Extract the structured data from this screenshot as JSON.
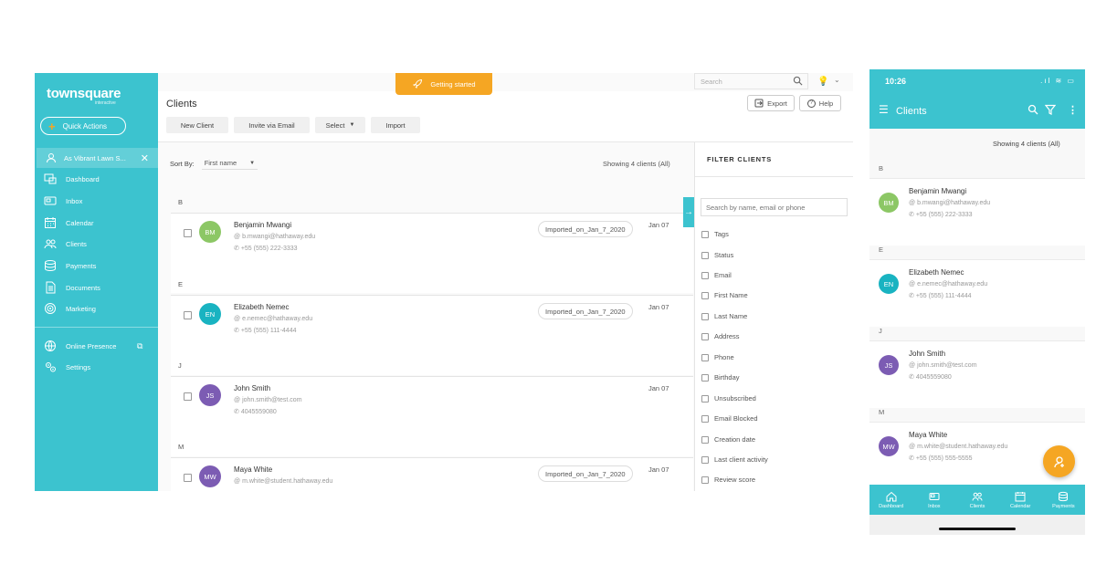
{
  "colors": {
    "accent": "#3cc3cf",
    "orange": "#f5a623",
    "avatar_green": "#8cc765",
    "avatar_teal": "#19b3c1",
    "avatar_purple": "#7c5cb3"
  },
  "desktop": {
    "brand": {
      "logo": "townsquare",
      "sub": "interactive"
    },
    "sidebar": {
      "quick_actions": "Quick Actions",
      "business": "As Vibrant Lawn S...",
      "items": [
        {
          "label": "Dashboard",
          "icon": "dashboard-icon"
        },
        {
          "label": "Inbox",
          "icon": "inbox-icon"
        },
        {
          "label": "Calendar",
          "icon": "calendar-icon"
        },
        {
          "label": "Clients",
          "icon": "clients-icon"
        },
        {
          "label": "Payments",
          "icon": "payments-icon"
        },
        {
          "label": "Documents",
          "icon": "documents-icon"
        },
        {
          "label": "Marketing",
          "icon": "marketing-icon"
        },
        {
          "label": "Online Presence",
          "icon": "globe-icon"
        },
        {
          "label": "Settings",
          "icon": "settings-icon"
        }
      ]
    },
    "topbar": {
      "getting_started": "Getting started",
      "search_placeholder": "Search"
    },
    "header": {
      "title": "Clients",
      "export": "Export",
      "help": "Help",
      "buttons": {
        "new_client": "New Client",
        "invite": "Invite via Email",
        "select": "Select",
        "import": "Import"
      }
    },
    "list": {
      "sort_label": "Sort By:",
      "sort_value": "First name",
      "showing": "Showing 4 clients (All)",
      "groups": [
        {
          "letter": "B",
          "client": {
            "initials": "BM",
            "name": "Benjamin Mwangi",
            "email": "b.mwangi@hathaway.edu",
            "phone": "+55 (555) 222-3333",
            "tag": "Imported_on_Jan_7_2020",
            "date": "Jan 07"
          }
        },
        {
          "letter": "E",
          "client": {
            "initials": "EN",
            "name": "Elizabeth Nemec",
            "email": "e.nemec@hathaway.edu",
            "phone": "+55 (555) 111-4444",
            "tag": "Imported_on_Jan_7_2020",
            "date": "Jan 07"
          }
        },
        {
          "letter": "J",
          "client": {
            "initials": "JS",
            "name": "John Smith",
            "email": "john.smith@test.com",
            "phone": "4045559080",
            "tag": "",
            "date": "Jan 07"
          }
        },
        {
          "letter": "M",
          "client": {
            "initials": "MW",
            "name": "Maya White",
            "email": "m.white@student.hathaway.edu",
            "phone": "",
            "tag": "Imported_on_Jan_7_2020",
            "date": "Jan 07"
          }
        }
      ]
    },
    "filter": {
      "title": "FILTER CLIENTS",
      "search_placeholder": "Search by name, email or phone",
      "options": [
        "Tags",
        "Status",
        "Email",
        "First Name",
        "Last Name",
        "Address",
        "Phone",
        "Birthday",
        "Unsubscribed",
        "Email Blocked",
        "Creation date",
        "Last client activity",
        "Review score"
      ]
    }
  },
  "mobile": {
    "time": "10:26",
    "title": "Clients",
    "showing": "Showing 4 clients (All)",
    "groups": [
      {
        "letter": "B",
        "client": {
          "initials": "BM",
          "name": "Benjamin Mwangi",
          "email": "b.mwangi@hathaway.edu",
          "phone": "+55 (555) 222-3333"
        }
      },
      {
        "letter": "E",
        "client": {
          "initials": "EN",
          "name": "Elizabeth Nemec",
          "email": "e.nemec@hathaway.edu",
          "phone": "+55 (555) 111-4444"
        }
      },
      {
        "letter": "J",
        "client": {
          "initials": "JS",
          "name": "John Smith",
          "email": "john.smith@test.com",
          "phone": "4045559080"
        }
      },
      {
        "letter": "M",
        "client": {
          "initials": "MW",
          "name": "Maya White",
          "email": "m.white@student.hathaway.edu",
          "phone": "+55 (555) 555-5555"
        }
      }
    ],
    "tabs": [
      {
        "label": "Dashboard",
        "icon": "home-icon"
      },
      {
        "label": "Inbox",
        "icon": "inbox-icon"
      },
      {
        "label": "Clients",
        "icon": "clients-icon"
      },
      {
        "label": "Calendar",
        "icon": "calendar-icon"
      },
      {
        "label": "Payments",
        "icon": "payments-icon"
      }
    ]
  }
}
